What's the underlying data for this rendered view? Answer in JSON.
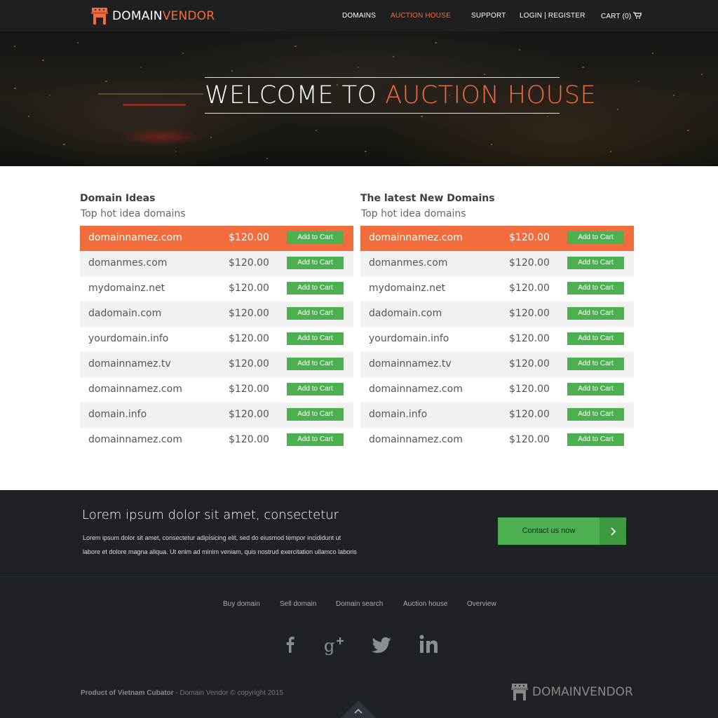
{
  "brand": {
    "name_white": "DOMAIN",
    "name_orange": "VENDOR",
    "footer_name": "DOMAINVENDOR"
  },
  "nav": {
    "domains": "DOMAINS",
    "auction_house": "AUCTION HOUSE",
    "support": "SUPPORT",
    "login": "LOGIN",
    "separator": "|",
    "register": "REGISTER",
    "cart": "CART (0)"
  },
  "hero": {
    "title_white": "WELCOME TO ",
    "title_orange": "AUCTION HOUSE"
  },
  "left_list": {
    "title": "Domain Ideas",
    "subtitle": "Top hot idea domains",
    "rows": [
      {
        "domain": "domainnamez.com",
        "price": "$120.00",
        "button": "Add to Cart"
      },
      {
        "domain": "domanmes.com",
        "price": "$120.00",
        "button": "Add to Cart"
      },
      {
        "domain": "mydomainz.net",
        "price": "$120.00",
        "button": "Add to Cart"
      },
      {
        "domain": "dadomain.com",
        "price": "$120.00",
        "button": "Add to Cart"
      },
      {
        "domain": "yourdomain.info",
        "price": "$120.00",
        "button": "Add to Cart"
      },
      {
        "domain": "domainnamez.tv",
        "price": "$120.00",
        "button": "Add to Cart"
      },
      {
        "domain": "domainnamez.com",
        "price": "$120.00",
        "button": "Add to Cart"
      },
      {
        "domain": "domain.info",
        "price": "$120.00",
        "button": "Add to Cart"
      },
      {
        "domain": "domainnamez.com",
        "price": "$120.00",
        "button": "Add to Cart"
      }
    ]
  },
  "right_list": {
    "title": "The latest New Domains",
    "subtitle": "Top hot idea domains",
    "rows": [
      {
        "domain": "domainnamez.com",
        "price": "$120.00",
        "button": "Add to Cart"
      },
      {
        "domain": "domanmes.com",
        "price": "$120.00",
        "button": "Add to Cart"
      },
      {
        "domain": "mydomainz.net",
        "price": "$120.00",
        "button": "Add to Cart"
      },
      {
        "domain": "dadomain.com",
        "price": "$120.00",
        "button": "Add to Cart"
      },
      {
        "domain": "yourdomain.info",
        "price": "$120.00",
        "button": "Add to Cart"
      },
      {
        "domain": "domainnamez.tv",
        "price": "$120.00",
        "button": "Add to Cart"
      },
      {
        "domain": "domainnamez.com",
        "price": "$120.00",
        "button": "Add to Cart"
      },
      {
        "domain": "domain.info",
        "price": "$120.00",
        "button": "Add to Cart"
      },
      {
        "domain": "domainnamez.com",
        "price": "$120.00",
        "button": "Add to Cart"
      }
    ]
  },
  "cta": {
    "title": "Lorem ipsum dolor sit amet, consectetur",
    "line1": "Lorem ipsum dolor sit amet, consectetur adipisicing elit, sed do eiusmod tempor incididunt ut",
    "line2": "labore et dolore magna aliqua. Ut enim ad minim veniam, quis nostrud exercitation ullamco laboris",
    "button": "Contact us now"
  },
  "footer": {
    "links": [
      "Buy domain",
      "Sell domain",
      "Domain search",
      "Auction house",
      "Overview"
    ],
    "social_icons": [
      "facebook-icon",
      "google-plus-icon",
      "twitter-icon",
      "linkedin-icon"
    ],
    "credit_bold": "Product of Vietnam Cubator",
    "credit_rest": " - Domain Vendor © copyright 2015"
  },
  "colors": {
    "accent": "#f26d3d",
    "green": "#4caf50",
    "dark": "#1e2226",
    "topbar": "#1d1f21"
  }
}
